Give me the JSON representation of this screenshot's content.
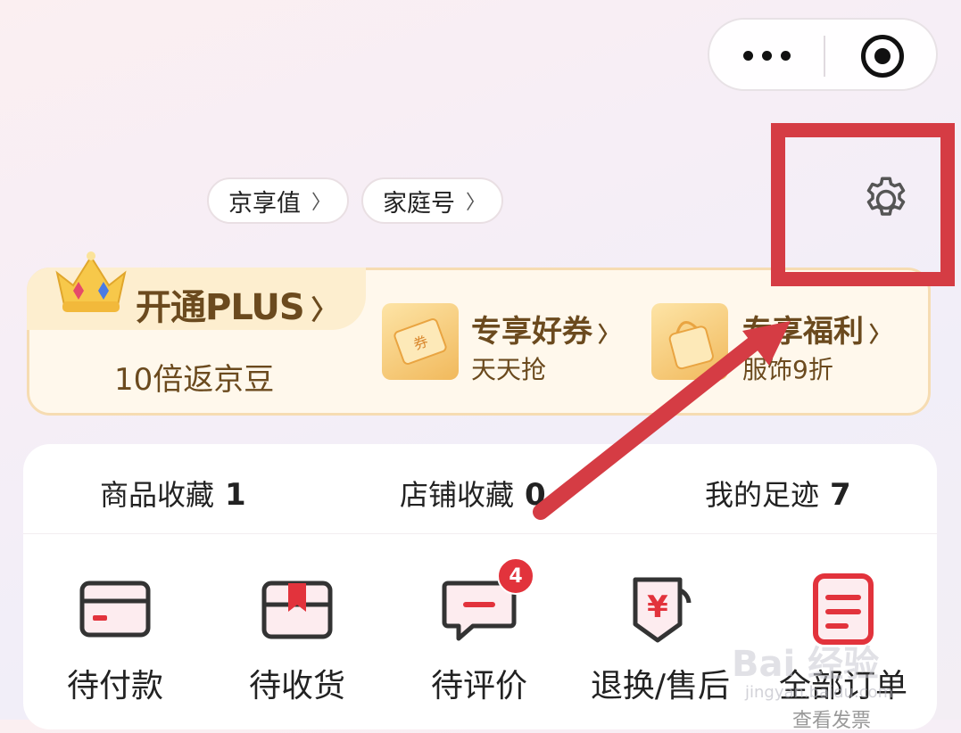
{
  "header": {
    "menu_icon": "more-dots-icon",
    "close_icon": "target-icon"
  },
  "account_links": {
    "jingxiang_label": "京享值",
    "family_label": "家庭号"
  },
  "settings": {
    "icon": "gear-icon"
  },
  "plus_card": {
    "title": "开通PLUS",
    "subtitle": "10倍返京豆",
    "coupon": {
      "title": "专享好券",
      "subtitle": "天天抢",
      "thumb_text": "券"
    },
    "welfare": {
      "title": "专享福利",
      "subtitle": "服饰9折"
    }
  },
  "stats": [
    {
      "label": "商品收藏",
      "count": "1"
    },
    {
      "label": "店铺收藏",
      "count": "0"
    },
    {
      "label": "我的足迹",
      "count": "7"
    }
  ],
  "orders": [
    {
      "label": "待付款",
      "icon": "card-icon"
    },
    {
      "label": "待收货",
      "icon": "package-icon"
    },
    {
      "label": "待评价",
      "icon": "comment-icon",
      "badge": "4"
    },
    {
      "label": "退换/售后",
      "icon": "refund-icon"
    },
    {
      "label": "全部订单",
      "icon": "order-list-icon"
    }
  ],
  "all_orders_sub": "查看发票",
  "watermark": {
    "main": "Bai 经验",
    "sub": "jingyan.baidu.com"
  },
  "colors": {
    "annotation_red": "#d53c44",
    "plus_brown": "#6b4a1e",
    "badge_red": "#e2333c"
  }
}
